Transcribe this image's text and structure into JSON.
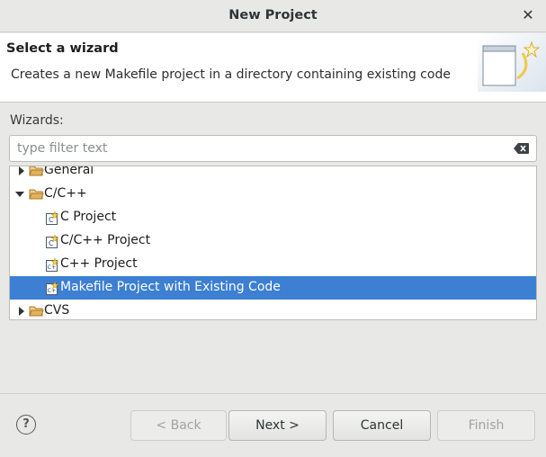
{
  "window": {
    "title": "New Project",
    "close_glyph": "✕"
  },
  "banner": {
    "title": "Select a wizard",
    "description": "Creates a new Makefile project in a directory containing existing code",
    "graphic_icon": "wizard-banner-icon"
  },
  "wizards_label": "Wizards:",
  "filter": {
    "value": "",
    "placeholder": "type filter text",
    "clear_icon": "clear-text-icon"
  },
  "tree": {
    "items": [
      {
        "label": "General",
        "kind": "folder",
        "expanded": false,
        "depth": 0
      },
      {
        "label": "C/C++",
        "kind": "folder",
        "expanded": true,
        "depth": 0
      },
      {
        "label": "C Project",
        "kind": "project",
        "depth": 1
      },
      {
        "label": "C/C++ Project",
        "kind": "project",
        "depth": 1
      },
      {
        "label": "C++ Project",
        "kind": "project",
        "depth": 1
      },
      {
        "label": "Makefile Project with Existing Code",
        "kind": "project",
        "depth": 1,
        "selected": true
      },
      {
        "label": "CVS",
        "kind": "folder",
        "expanded": false,
        "depth": 0
      }
    ]
  },
  "footer": {
    "help_glyph": "?",
    "back_label": "< Back",
    "next_label": "Next >",
    "cancel_label": "Cancel",
    "finish_label": "Finish"
  },
  "colors": {
    "selection": "#3c7fd3",
    "folder": "#e3b25a"
  }
}
